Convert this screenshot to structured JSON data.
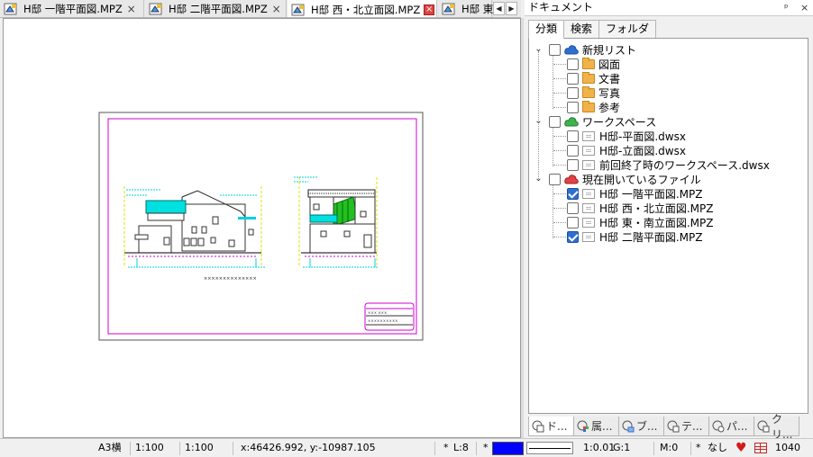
{
  "tabs": [
    {
      "label": "H邸 一階平面図.MPZ",
      "close": "×",
      "active": false
    },
    {
      "label": "H邸 二階平面図.MPZ",
      "close": "×",
      "active": false
    },
    {
      "label": "H邸 西・北立面図.MPZ",
      "close": "×",
      "active": true
    },
    {
      "label": "H邸 東"
    }
  ],
  "tab_nav": {
    "prev": "◀",
    "next": "▶"
  },
  "panel": {
    "title": "ドキュメント",
    "pin": "ᵖ",
    "close": "×",
    "tabs": [
      "分類",
      "検索",
      "フォルダ"
    ],
    "tree": [
      {
        "label": "新規リスト",
        "icon": "cloud-blue-icon",
        "checked": false,
        "children": [
          {
            "label": "図面",
            "icon": "folder-icon",
            "checked": false
          },
          {
            "label": "文書",
            "icon": "folder-icon",
            "checked": false
          },
          {
            "label": "写真",
            "icon": "folder-icon",
            "checked": false
          },
          {
            "label": "参考",
            "icon": "folder-icon",
            "checked": false
          }
        ]
      },
      {
        "label": "ワークスペース",
        "icon": "cloud-green-icon",
        "checked": false,
        "children": [
          {
            "label": "H邸-平面図.dwsx",
            "icon": "document-icon",
            "checked": false
          },
          {
            "label": "H邸-立面図.dwsx",
            "icon": "document-icon",
            "checked": false
          },
          {
            "label": "前回終了時のワークスペース.dwsx",
            "icon": "document-icon",
            "checked": false
          }
        ]
      },
      {
        "label": "現在開いているファイル",
        "icon": "cloud-red-icon",
        "checked": false,
        "children": [
          {
            "label": "H邸 一階平面図.MPZ",
            "icon": "document-icon",
            "checked": true
          },
          {
            "label": "H邸 西・北立面図.MPZ",
            "icon": "document-icon",
            "checked": false
          },
          {
            "label": "H邸 東・南立面図.MPZ",
            "icon": "document-icon",
            "checked": false
          },
          {
            "label": "H邸 二階平面図.MPZ",
            "icon": "document-icon",
            "checked": true
          }
        ]
      }
    ],
    "bottom_tabs": [
      "ド...",
      "属...",
      "ブ...",
      "テ...",
      "パ...",
      "クリ..."
    ]
  },
  "status": {
    "paper": "A3横",
    "scale1": "1:100",
    "scale2": "1:100",
    "coords": "x:46426.992, y:-10987.105",
    "layer_mark": "*",
    "layer": "L:8",
    "color_mark": "*",
    "color": "#0000ff",
    "ratio": "1:0.01",
    "group": "G:1",
    "mode": "M:0",
    "fill_mark": "*",
    "fill": "なし",
    "count": "1040"
  },
  "colors": {
    "accent": "#2f6fd0",
    "frame": "#d000d0",
    "drawing_cyan": "#00d0e0",
    "drawing_green": "#22c022"
  }
}
